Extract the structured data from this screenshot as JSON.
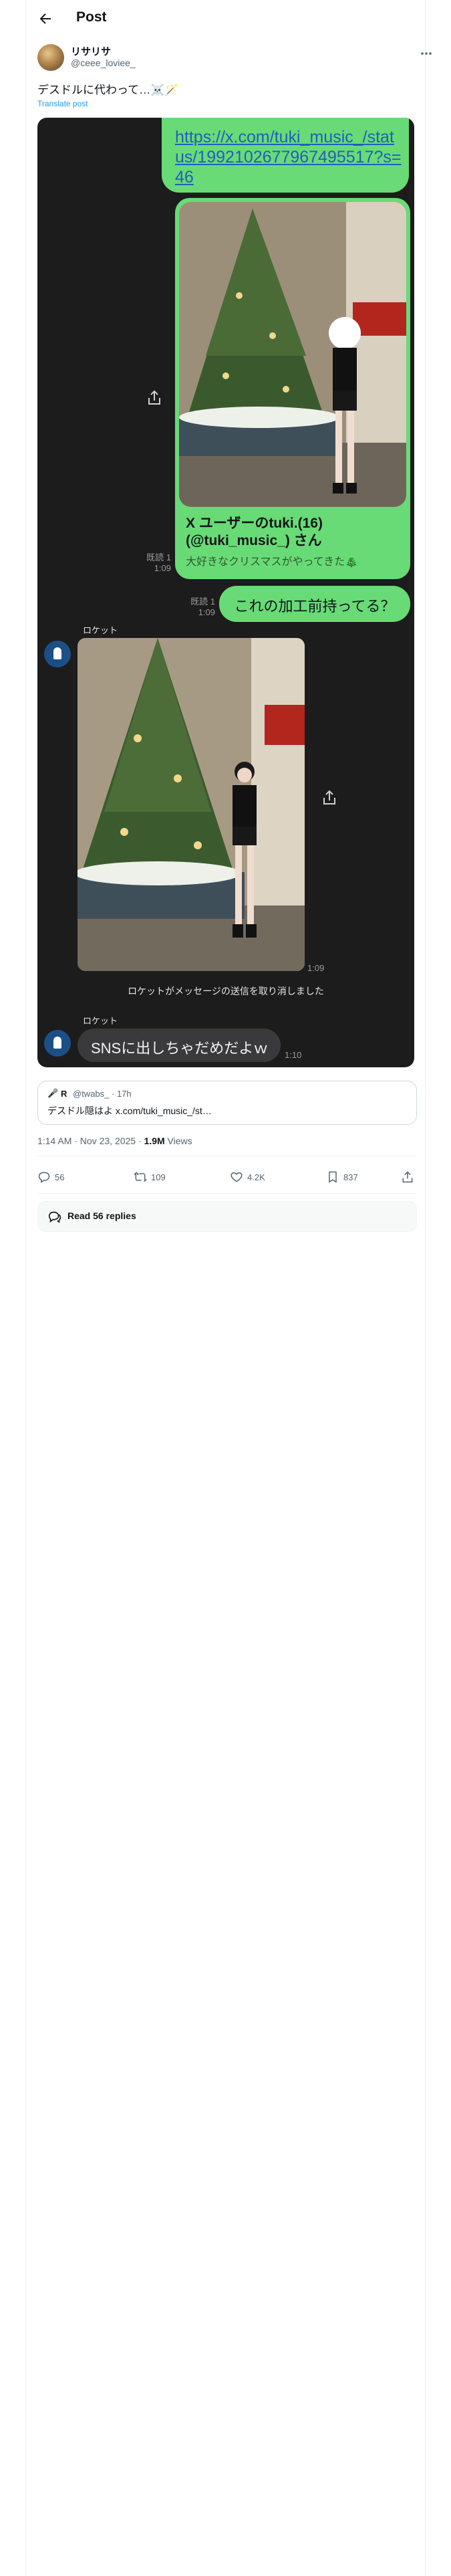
{
  "header": {
    "title": "Post"
  },
  "author": {
    "display_name": "リサリサ",
    "username": "@ceee_loviee_"
  },
  "post": {
    "text": "デスドルに代わって…☠️🪄",
    "translate_label": "Translate post"
  },
  "media": {
    "link_bubble": "https://x.com/tuki_music_/status/1992102677967495517?s=46",
    "card_title": "X ユーザーのtuki.(16)(@tuki_music_) さん",
    "card_subtitle": "大好きなクリスマスがやってきた🎄",
    "meta_read_1": "既読 1",
    "meta_time_1": "1:09",
    "question_bubble": "これの加工前持ってる？",
    "meta_read_2": "既読 1",
    "meta_time_2": "1:09",
    "sender_1": "ロケット",
    "photo_time": "1:09",
    "system_message": "ロケットがメッセージの送信を取り消しました",
    "sender_2": "ロケット",
    "sns_bubble": "SNSに出しちゃだめだよｗ",
    "sns_time": "1:10"
  },
  "quote": {
    "avatar": "🎤",
    "name": "R",
    "handle": "@twabs_ · 17h",
    "text": "デスドル隠はよ x.com/tuki_music_/st…"
  },
  "timestamp": {
    "text": "1:14 AM · Nov 23, 2025 · ",
    "views": "1.9M",
    "views_label": " Views"
  },
  "actions": {
    "replies": "56",
    "reposts": "109",
    "likes": "4.2K",
    "bookmarks": "837"
  },
  "read_replies": "Read 56 replies",
  "colors": {
    "bubble_green": "#68db76",
    "chat_bg": "#1c1c1c",
    "link_blue": "#1d9bf0"
  }
}
